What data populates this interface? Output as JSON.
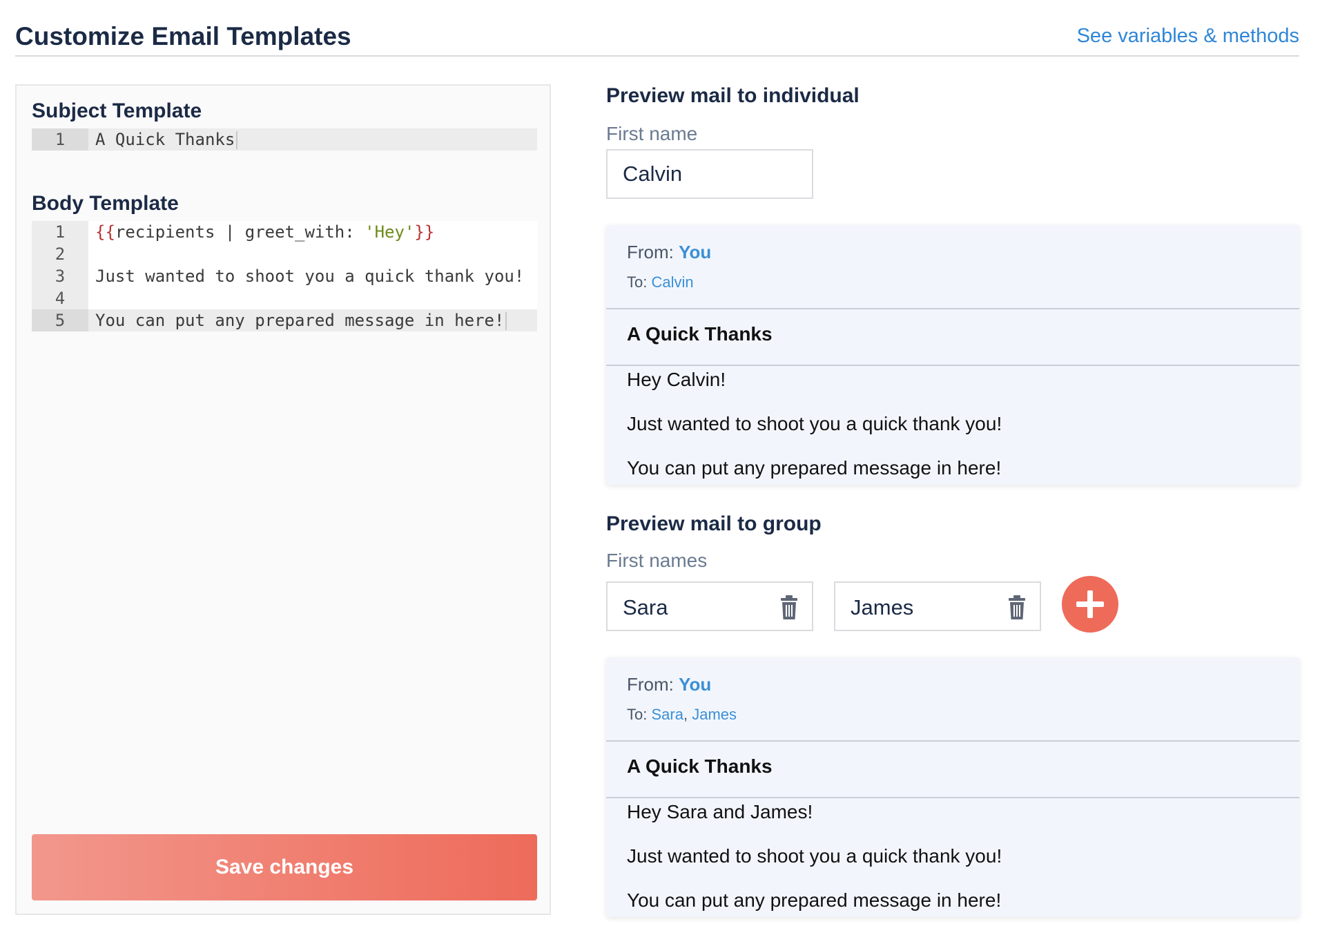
{
  "header": {
    "title": "Customize Email Templates",
    "link": "See variables & methods"
  },
  "subject_template": {
    "title": "Subject Template",
    "lines": [
      {
        "num": "1",
        "text": "A Quick Thanks"
      }
    ]
  },
  "body_template": {
    "title": "Body Template",
    "lines": [
      {
        "num": "1",
        "brace_open": "{{",
        "text_a": "recipients | greet_with: ",
        "string": "'Hey'",
        "brace_close": "}}"
      },
      {
        "num": "2",
        "text": ""
      },
      {
        "num": "3",
        "text": "Just wanted to shoot you a quick thank you!"
      },
      {
        "num": "4",
        "text": ""
      },
      {
        "num": "5",
        "text": "You can put any prepared message in here!"
      }
    ]
  },
  "save_button": "Save changes",
  "individual": {
    "title": "Preview mail to individual",
    "field_label": "First name",
    "first_name": "Calvin",
    "mail": {
      "from_label": "From:",
      "from": "You",
      "to_label": "To:",
      "to": "Calvin",
      "subject": "A Quick Thanks",
      "body": [
        "Hey Calvin!",
        "Just wanted to shoot you a quick thank you!",
        "You can put any prepared message in here!"
      ]
    }
  },
  "group": {
    "title": "Preview mail to group",
    "field_label": "First names",
    "names": [
      "Sara",
      "James"
    ],
    "mail": {
      "from_label": "From:",
      "from": "You",
      "to_label": "To:",
      "to": [
        "Sara",
        "James"
      ],
      "separator": ", ",
      "subject": "A Quick Thanks",
      "body": [
        "Hey Sara and James!",
        "Just wanted to shoot you a quick thank you!",
        "You can put any prepared message in here!"
      ]
    }
  },
  "colors": {
    "accent": "#ee6b5a",
    "link": "#2f86d6",
    "heading": "#1b2a45",
    "card_bg": "#f2f6fc"
  }
}
